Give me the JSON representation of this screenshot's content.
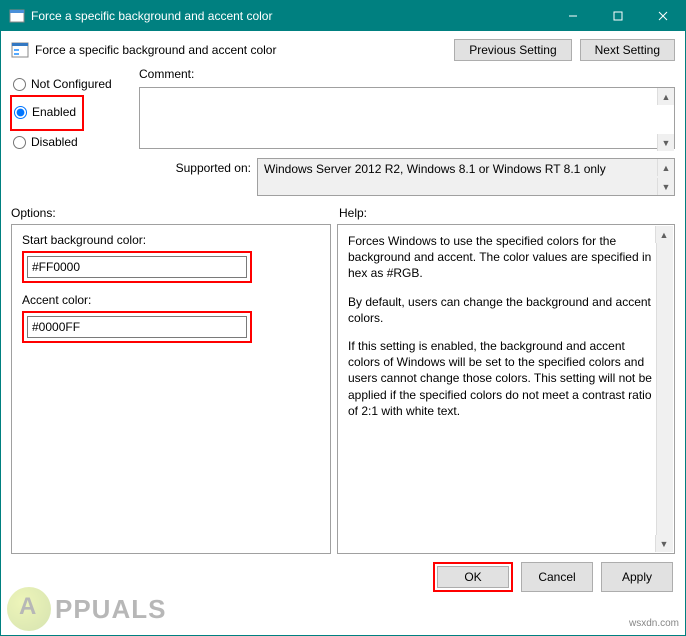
{
  "window": {
    "title": "Force a specific background and accent color"
  },
  "policy": {
    "title": "Force a specific background and accent color"
  },
  "nav": {
    "previous": "Previous Setting",
    "next": "Next Setting"
  },
  "radios": {
    "not_configured": "Not Configured",
    "enabled": "Enabled",
    "disabled": "Disabled",
    "selected": "enabled"
  },
  "upper": {
    "comment_label": "Comment:",
    "comment_value": "",
    "supported_label": "Supported on:",
    "supported_value": "Windows Server 2012 R2, Windows 8.1 or Windows RT 8.1 only"
  },
  "sections": {
    "options": "Options:",
    "help": "Help:"
  },
  "fields": {
    "bg_label": "Start background color:",
    "bg_value": "#FF0000",
    "accent_label": "Accent color:",
    "accent_value": "#0000FF"
  },
  "help": {
    "p1": "Forces Windows to use the specified colors for the background and accent. The color values are specified in hex as #RGB.",
    "p2": "By default, users can change the background and accent colors.",
    "p3": "If this setting is enabled, the background and accent colors of Windows will be set to the specified colors and users cannot change those colors. This setting will not be applied if the specified colors do not meet a contrast ratio of 2:1 with white text."
  },
  "buttons": {
    "ok": "OK",
    "cancel": "Cancel",
    "apply": "Apply"
  },
  "watermark": {
    "brand": "PPUALS",
    "source": "wsxdn.com"
  }
}
